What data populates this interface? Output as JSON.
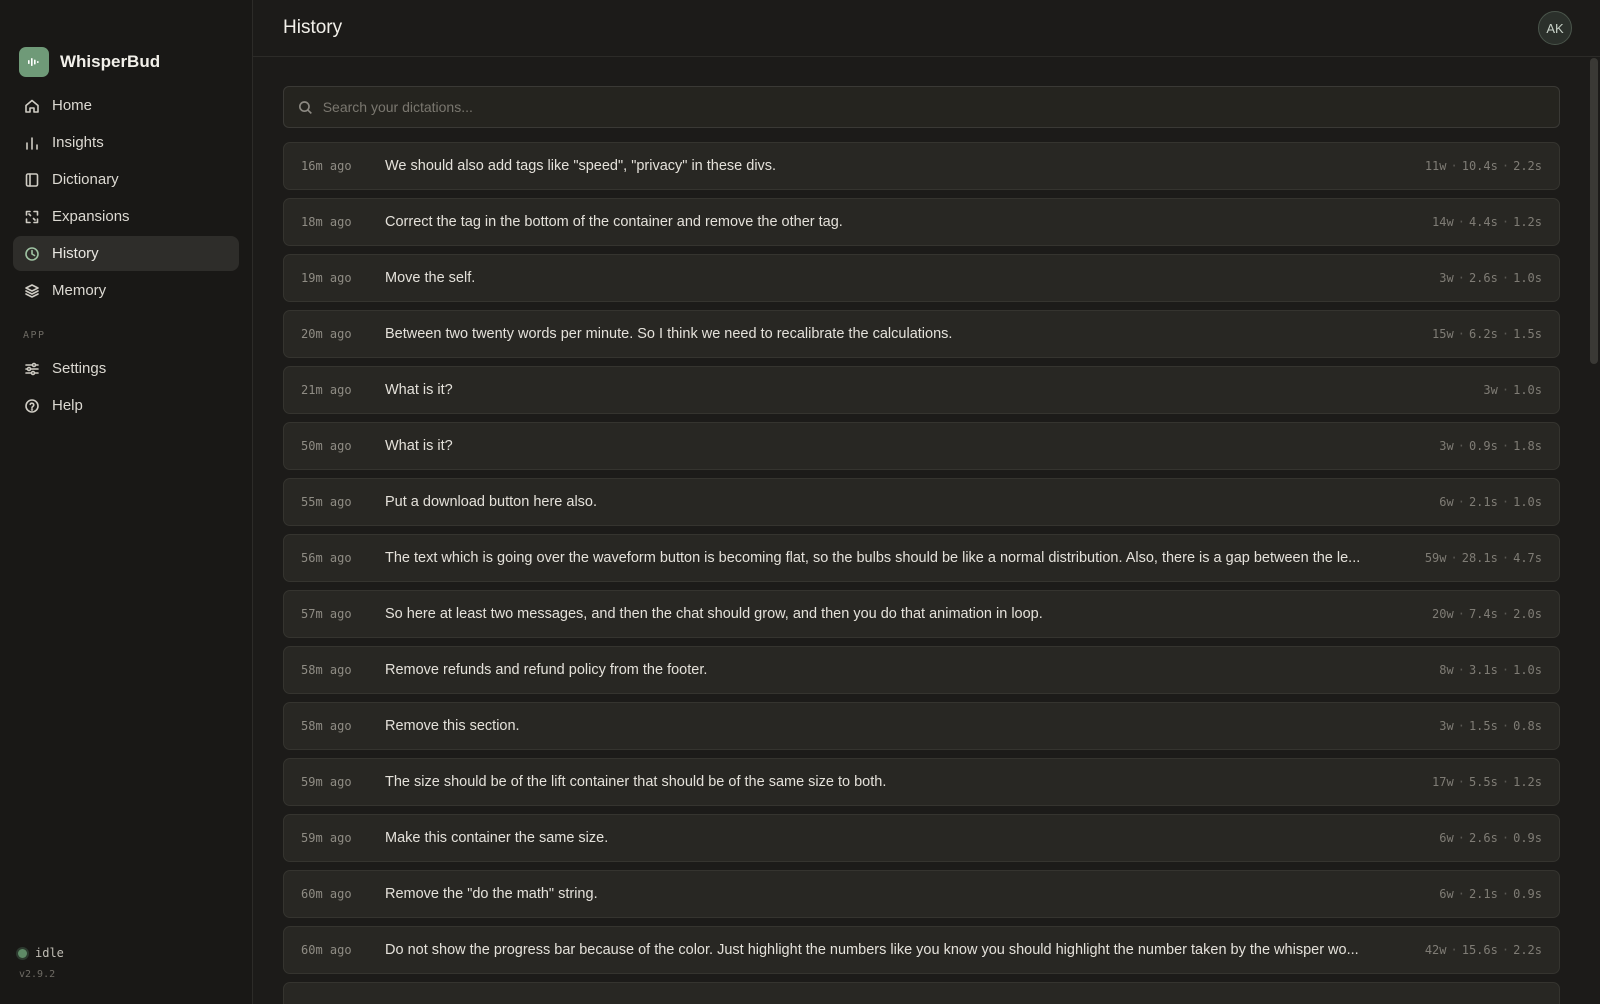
{
  "app": {
    "name": "WhisperBud",
    "version": "v2.9.2",
    "status": "idle"
  },
  "colors": {
    "accent": "#6f9a78",
    "active_bg": "#2e2d2a",
    "bg": "#1c1b19"
  },
  "sidebar": {
    "items": [
      {
        "label": "Home",
        "icon": "home-icon"
      },
      {
        "label": "Insights",
        "icon": "bar-chart-icon"
      },
      {
        "label": "Dictionary",
        "icon": "book-icon"
      },
      {
        "label": "Expansions",
        "icon": "expand-icon"
      },
      {
        "label": "History",
        "icon": "clock-icon",
        "active": true
      },
      {
        "label": "Memory",
        "icon": "layers-icon"
      }
    ],
    "section_label": "APP",
    "app_items": [
      {
        "label": "Settings",
        "icon": "sliders-icon"
      },
      {
        "label": "Help",
        "icon": "help-circle-icon"
      }
    ]
  },
  "header": {
    "title": "History",
    "avatar_initials": "AK"
  },
  "search": {
    "placeholder": "Search your dictations..."
  },
  "history": [
    {
      "time": "16m ago",
      "text": "We should also add tags like \"speed\", \"privacy\" in these divs.",
      "words": "11w",
      "duration": "10.4s",
      "latency": "2.2s"
    },
    {
      "time": "18m ago",
      "text": "Correct the tag in the bottom of the container and remove the other tag.",
      "words": "14w",
      "duration": "4.4s",
      "latency": "1.2s"
    },
    {
      "time": "19m ago",
      "text": "Move the self.",
      "words": "3w",
      "duration": "2.6s",
      "latency": "1.0s"
    },
    {
      "time": "20m ago",
      "text": "Between two twenty words per minute. So I think we need to recalibrate the calculations.",
      "words": "15w",
      "duration": "6.2s",
      "latency": "1.5s"
    },
    {
      "time": "21m ago",
      "text": "What is it?",
      "words": "3w",
      "duration": null,
      "latency": "1.0s"
    },
    {
      "time": "50m ago",
      "text": "What is it?",
      "words": "3w",
      "duration": "0.9s",
      "latency": "1.8s"
    },
    {
      "time": "55m ago",
      "text": "Put a download button here also.",
      "words": "6w",
      "duration": "2.1s",
      "latency": "1.0s"
    },
    {
      "time": "56m ago",
      "text": "The text which is going over the waveform button is becoming flat, so the bulbs should be like a normal distribution. Also, there is a gap between the le...",
      "words": "59w",
      "duration": "28.1s",
      "latency": "4.7s"
    },
    {
      "time": "57m ago",
      "text": "So here at least two messages, and then the chat should grow, and then you do that animation in loop.",
      "words": "20w",
      "duration": "7.4s",
      "latency": "2.0s"
    },
    {
      "time": "58m ago",
      "text": "Remove refunds and refund policy from the footer.",
      "words": "8w",
      "duration": "3.1s",
      "latency": "1.0s"
    },
    {
      "time": "58m ago",
      "text": "Remove this section.",
      "words": "3w",
      "duration": "1.5s",
      "latency": "0.8s"
    },
    {
      "time": "59m ago",
      "text": "The size should be of the lift container that should be of the same size to both.",
      "words": "17w",
      "duration": "5.5s",
      "latency": "1.2s"
    },
    {
      "time": "59m ago",
      "text": "Make this container the same size.",
      "words": "6w",
      "duration": "2.6s",
      "latency": "0.9s"
    },
    {
      "time": "60m ago",
      "text": "Remove the \"do the math\" string.",
      "words": "6w",
      "duration": "2.1s",
      "latency": "0.9s"
    },
    {
      "time": "60m ago",
      "text": "Do not show the progress bar because of the color. Just highlight the numbers like you know you should highlight the number taken by the whisper wo...",
      "words": "42w",
      "duration": "15.6s",
      "latency": "2.2s"
    },
    {
      "time": "",
      "text": "",
      "words": "",
      "duration": "",
      "latency": ""
    }
  ]
}
